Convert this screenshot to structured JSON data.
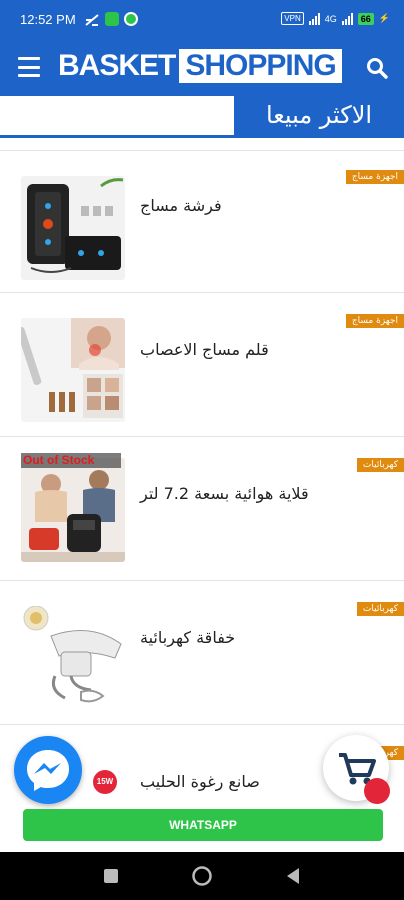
{
  "status": {
    "time": "12:52 PM",
    "vpn": "VPN",
    "battery": "66",
    "network": "4G"
  },
  "header": {
    "logo_part1": "BASKET",
    "logo_part2": "SHOPPING"
  },
  "section": {
    "title": "الاكثر مبيعا"
  },
  "products": [
    {
      "name": "فرشة مساج",
      "category": "اجهزة مساج"
    },
    {
      "name": "قلم مساج الاعصاب",
      "category": "اجهزة مساج"
    },
    {
      "name": "قلاية هوائية بسعة 7.2 لتر",
      "category": "كهربائيات",
      "stock_label": "Out of Stock"
    },
    {
      "name": "خفاقة كهربائية",
      "category": "كهربائيات"
    },
    {
      "name": "صانع رغوة الحليب",
      "category": "كهربائيات",
      "badge": "15W"
    }
  ],
  "whatsapp": {
    "label": "WHATSAPP"
  },
  "colors": {
    "primary": "#1e64c8",
    "badge": "#e08a10",
    "whatsapp": "#2ec44a",
    "accent_red": "#e3253a"
  }
}
